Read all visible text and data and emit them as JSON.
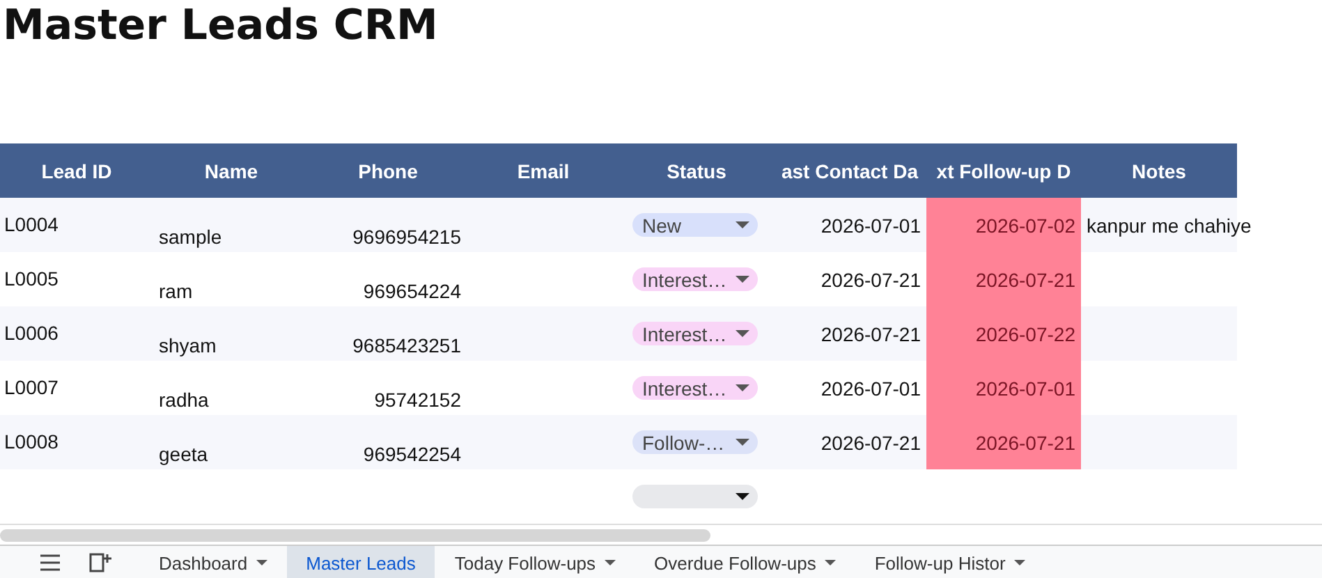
{
  "title": "Master Leads CRM",
  "table": {
    "columns": [
      "Lead ID",
      "Name",
      "Phone",
      "Email",
      "Status",
      "ast Contact Da",
      "xt Follow-up D",
      "Notes"
    ],
    "rows": [
      {
        "kind": "lead",
        "lead_id": "L0004",
        "name": "sample",
        "phone": "9696954215",
        "status": {
          "label": "New",
          "color": "#d8e0fb"
        },
        "last_contact": "2026-07-01",
        "next_follow_up": {
          "date": "2026-07-02",
          "highlighted": true
        },
        "notes": "kanpur me chahiye"
      },
      {
        "kind": "lead",
        "lead_id": "L0005",
        "name": "ram",
        "phone": "969654224",
        "status": {
          "label": "Interest…",
          "color": "#f9d5f7"
        },
        "last_contact": "2026-07-21",
        "next_follow_up": {
          "date": "2026-07-21",
          "highlighted": true
        }
      },
      {
        "kind": "lead",
        "lead_id": "L0006",
        "name": "shyam",
        "phone": "9685423251",
        "status": {
          "label": "Interest…",
          "color": "#f9d5f7"
        },
        "last_contact": "2026-07-21",
        "next_follow_up": {
          "date": "2026-07-22",
          "highlighted": true
        }
      },
      {
        "kind": "lead",
        "lead_id": "L0007",
        "name": "radha",
        "phone": "95742152",
        "status": {
          "label": "Interest…",
          "color": "#f9d5f7"
        },
        "last_contact": "2026-07-01",
        "next_follow_up": {
          "date": "2026-07-01",
          "highlighted": true
        }
      },
      {
        "kind": "lead",
        "lead_id": "L0008",
        "name": "geeta",
        "phone": "969542254",
        "status": {
          "label": "Follow-…",
          "color": "#dce2f8"
        },
        "last_contact": "2026-07-21",
        "next_follow_up": {
          "date": "2026-07-21",
          "highlighted": true
        }
      },
      {
        "kind": "blank",
        "status": {
          "color": "#e8e9ec"
        }
      }
    ]
  },
  "sheet_tabs": [
    {
      "label": "Dashboard",
      "selected": false
    },
    {
      "label": "Master Leads",
      "selected": true
    },
    {
      "label": "Today Follow-ups",
      "selected": false
    },
    {
      "label": "Overdue Follow-ups",
      "selected": false
    },
    {
      "label": "Follow-up Histor",
      "selected": false
    }
  ]
}
